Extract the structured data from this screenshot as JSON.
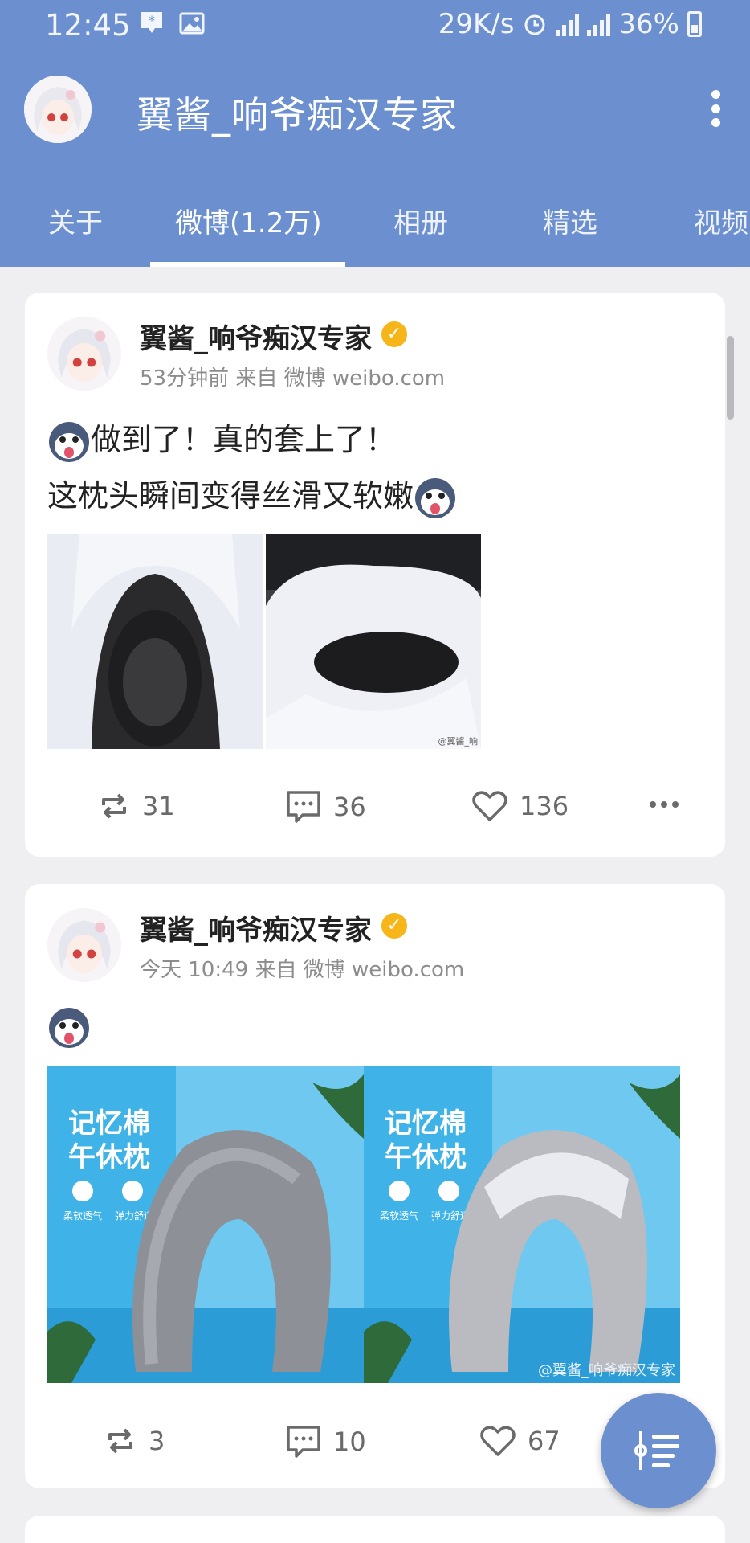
{
  "status_bar": {
    "time": "12:45",
    "net_speed": "29K/s",
    "battery": "36%",
    "icons": [
      "notification-icon",
      "gallery-icon",
      "alarm-icon",
      "signal-e-icon",
      "signal-4g-icon",
      "battery-icon"
    ]
  },
  "header": {
    "title": "翼酱_响爷痴汉专家",
    "menu_icon": "more-vertical-icon"
  },
  "tabs": [
    {
      "label": "关于"
    },
    {
      "label": "微博(1.2万)",
      "active": true
    },
    {
      "label": "相册"
    },
    {
      "label": "精选"
    },
    {
      "label": "视频"
    }
  ],
  "posts": [
    {
      "author": "翼酱_响爷痴汉专家",
      "verified": true,
      "meta": "53分钟前  来自 微博 weibo.com",
      "lines": [
        "做到了！真的套上了！",
        "这枕头瞬间变得丝滑又软嫩"
      ],
      "images": [
        {
          "desc": "pillow-photo-1"
        },
        {
          "desc": "pillow-photo-2",
          "watermark": "@翼酱_响"
        }
      ],
      "reposts": "31",
      "comments": "36",
      "likes": "136"
    },
    {
      "author": "翼酱_响爷痴汉专家",
      "verified": true,
      "meta": "今天 10:49  来自 微博 weibo.com",
      "lines": [],
      "images": [
        {
          "desc": "product-image-1",
          "headline": "记忆棉",
          "headline2": "午休枕",
          "tag1": "柔软透气",
          "tag2": "弹力舒适"
        },
        {
          "desc": "product-image-2",
          "headline": "记忆棉",
          "headline2": "午休枕",
          "tag1": "柔软透气",
          "tag2": "弹力舒适",
          "watermark": "@翼酱_响爷痴汉专家"
        }
      ],
      "reposts": "3",
      "comments": "10",
      "likes": "67"
    }
  ],
  "fab": {
    "icon": "sort-list-icon"
  },
  "colors": {
    "primary": "#6b8fcf",
    "verified": "#f6b519",
    "card_bg": "#ffffff",
    "page_bg": "#efeff1"
  }
}
